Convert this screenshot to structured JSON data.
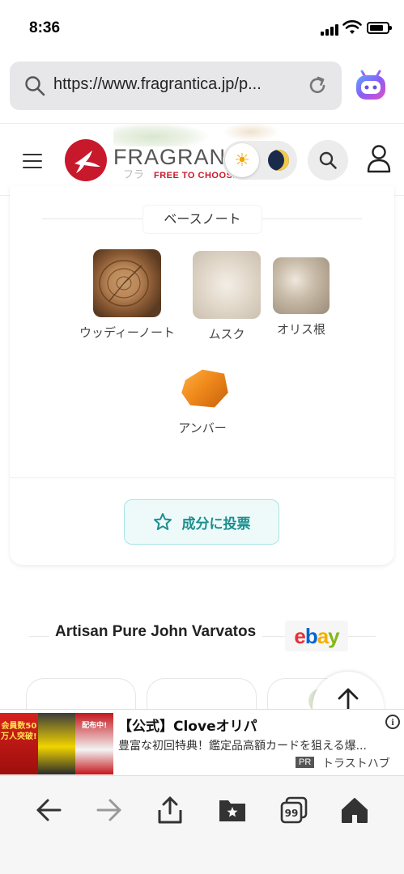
{
  "status_bar": {
    "time": "8:36"
  },
  "browser": {
    "url": "https://www.fragrantica.jp/p...",
    "icons": [
      "search-icon",
      "reload-icon",
      "extension-icon"
    ]
  },
  "site_header": {
    "logo_text": "FRAGRANTICA",
    "logo_tagline": "FREE TO CHOOSE",
    "logo_sub": "フラ",
    "icons": [
      "hamburger-icon",
      "sun-icon",
      "moon-icon",
      "search-icon",
      "user-icon"
    ]
  },
  "base_notes": {
    "title": "ベースノート",
    "notes": [
      {
        "label": "ウッディーノート"
      },
      {
        "label": "ムスク"
      },
      {
        "label": "オリス根"
      },
      {
        "label": "アンバー"
      }
    ],
    "vote_button": "成分に投票"
  },
  "related": {
    "title": "Artisan Pure John Varvatos",
    "ebay_letters": [
      "e",
      "b",
      "a",
      "y"
    ],
    "ebay_colors": [
      "#e53238",
      "#0064d2",
      "#f5af02",
      "#86b817"
    ]
  },
  "ad": {
    "thumb_text_1": "会員数50万人突破!",
    "thumb_text_3": "配布中!",
    "title": "【公式】Cloveオリパ",
    "description": "豊富な初回特典！鑑定品高額カードを狙える爆...",
    "pr_badge": "PR",
    "sponsor": "トラストハブ",
    "info": "i"
  },
  "toolbar": {
    "tabs_count": "99",
    "icons": [
      "back-icon",
      "forward-icon",
      "share-icon",
      "bookmarks-icon",
      "tabs-icon",
      "home-icon"
    ]
  },
  "colors": {
    "accent": "#1b8f8f",
    "brand": "#c8192c"
  }
}
